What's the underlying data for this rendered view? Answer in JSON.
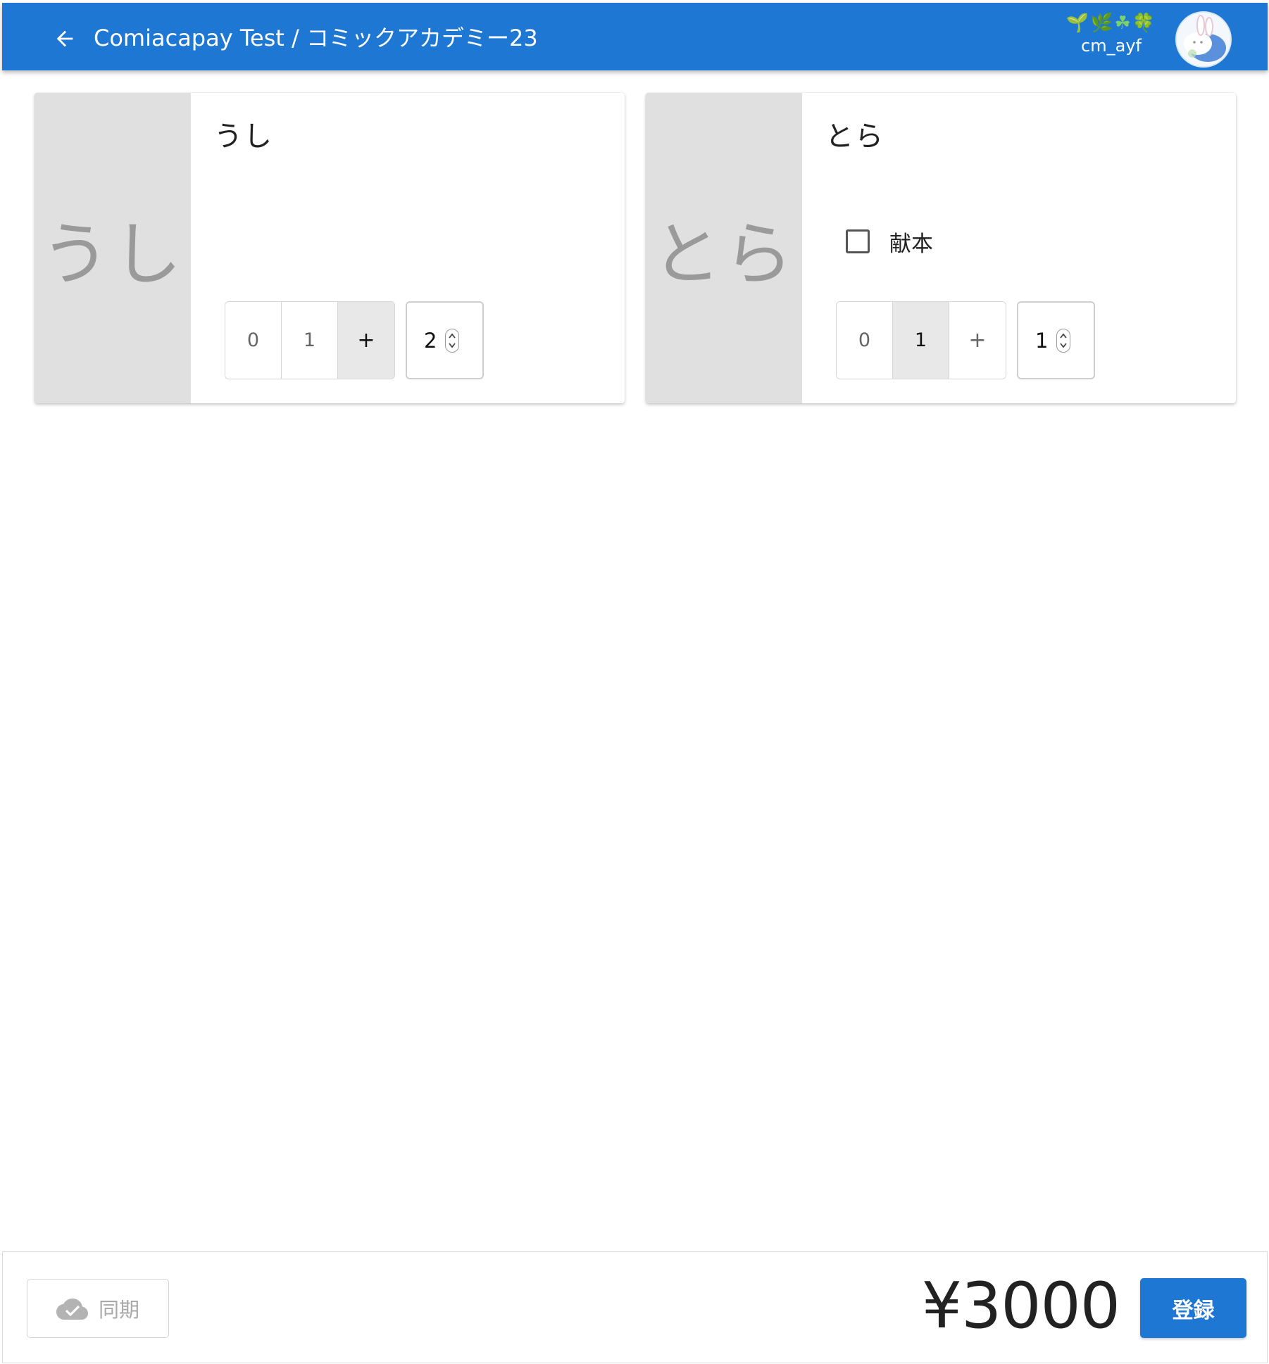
{
  "header": {
    "title": "Comiacapay Test / コミックアカデミー23",
    "user_decoration": "🌱🌿☘🍀",
    "user_name": "cm_ayf",
    "bar_color": "#1e78d3",
    "icons": {
      "back": "arrow-left-icon",
      "avatar": "rabbit-avatar"
    }
  },
  "items": [
    {
      "name": "うし",
      "thumb_text": "うし",
      "has_checkbox": false,
      "quantity_options": [
        "0",
        "1",
        "+"
      ],
      "quantity_selected": "+",
      "quantity_value": "2"
    },
    {
      "name": "とら",
      "thumb_text": "とら",
      "has_checkbox": true,
      "checkbox_label": "献本",
      "checkbox_checked": false,
      "quantity_options": [
        "0",
        "1",
        "+"
      ],
      "quantity_selected": "1",
      "quantity_value": "1"
    }
  ],
  "footer": {
    "sync_label": "同期",
    "sync_icon": "cloud-check-icon",
    "total": "¥3000",
    "register_label": "登録"
  }
}
